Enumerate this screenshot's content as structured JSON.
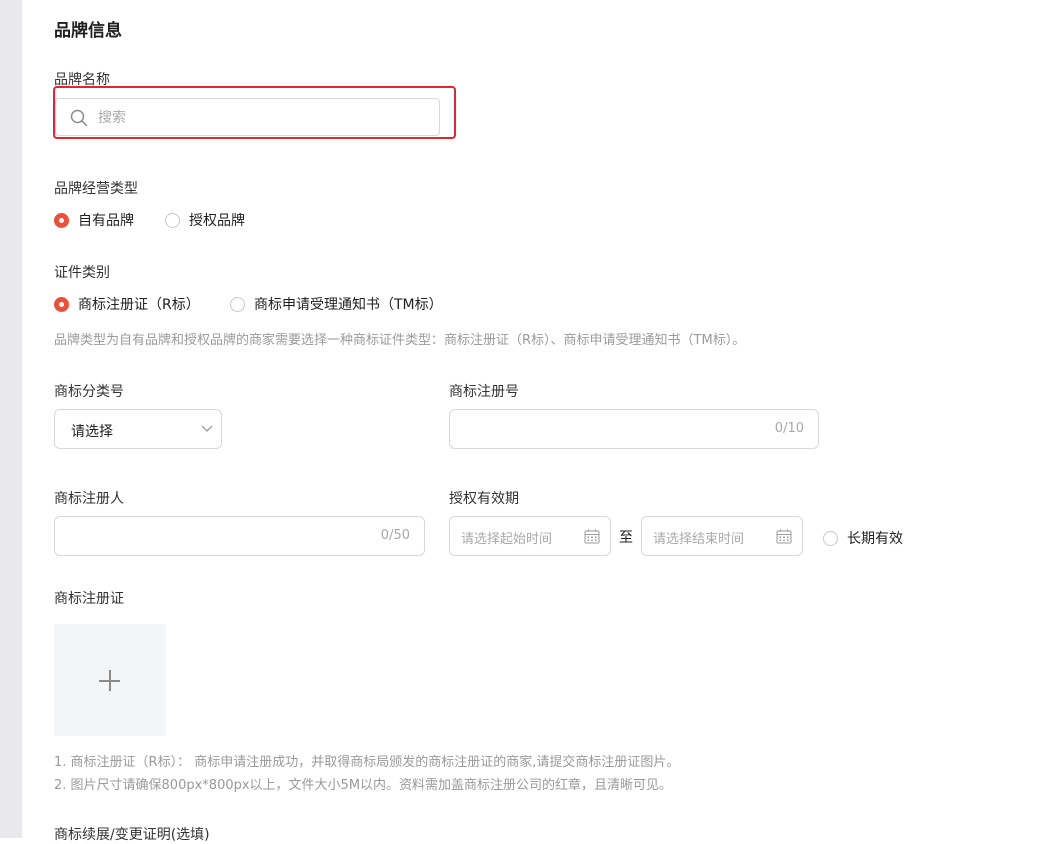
{
  "section": {
    "title": "品牌信息"
  },
  "brand_name": {
    "label": "品牌名称",
    "placeholder": "搜索"
  },
  "brand_type": {
    "label": "品牌经营类型",
    "options": [
      {
        "label": "自有品牌",
        "selected": true
      },
      {
        "label": "授权品牌",
        "selected": false
      }
    ]
  },
  "cert_type": {
    "label": "证件类别",
    "options": [
      {
        "label": "商标注册证（R标）",
        "selected": true
      },
      {
        "label": "商标申请受理通知书（TM标）",
        "selected": false
      }
    ],
    "hint": "品牌类型为自有品牌和授权品牌的商家需要选择一种商标证件类型：商标注册证（R标）、商标申请受理通知书（TM标）。"
  },
  "trademark_class": {
    "label": "商标分类号",
    "value": "请选择"
  },
  "trademark_reg_no": {
    "label": "商标注册号",
    "counter": "0/10"
  },
  "trademark_registrant": {
    "label": "商标注册人",
    "counter": "0/50"
  },
  "auth_period": {
    "label": "授权有效期",
    "start_placeholder": "请选择起始时间",
    "separator": "至",
    "end_placeholder": "请选择结束时间",
    "long_term_label": "长期有效"
  },
  "trademark_cert": {
    "label": "商标注册证",
    "notes": [
      "1. 商标注册证（R标）： 商标申请注册成功，并取得商标局颁发的商标注册证的商家,请提交商标注册证图片。",
      "2. 图片尺寸请确保800px*800px以上，文件大小5M以内。资料需加盖商标注册公司的红章，且清晰可见。"
    ]
  },
  "renewal": {
    "label": "商标续展/变更证明(选填)"
  },
  "colors": {
    "accent": "#ee4f38",
    "highlight_border": "#e3262a",
    "sidebar": "#e9e9ec"
  }
}
